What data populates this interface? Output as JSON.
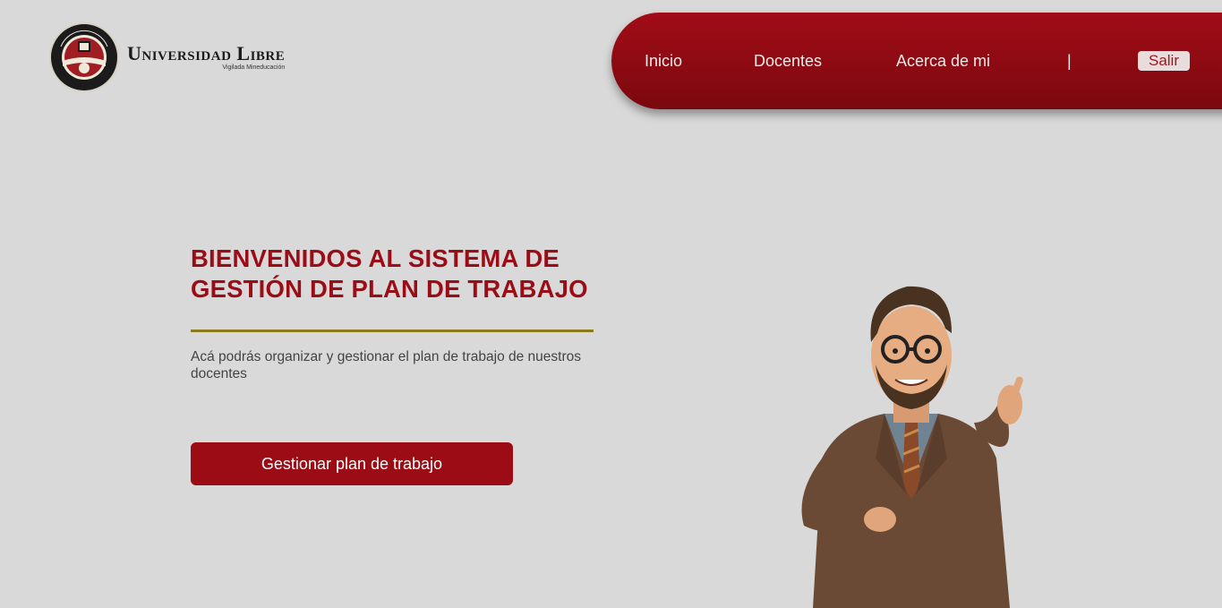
{
  "brand": {
    "name": "Universidad Libre",
    "tagline": "Vigilada Mineducación",
    "seal_top": "UNIVERSIDAD LIBRE",
    "seal_bottom": "COLOMBIA",
    "seal_motto": [
      "SCIENTIA",
      "VERITAS",
      "FRATERNITAS"
    ]
  },
  "nav": {
    "items": [
      {
        "label": "Inicio"
      },
      {
        "label": "Docentes"
      },
      {
        "label": "Acerca de mi"
      }
    ],
    "separator": "|",
    "logout_label": "Salir"
  },
  "hero": {
    "title": "BIENVENIDOS AL SISTEMA DE GESTIÓN DE PLAN DE TRABAJO",
    "description": "Acá podrás organizar y gestionar el plan de trabajo de nuestros docentes",
    "cta_label": "Gestionar plan de trabajo"
  },
  "colors": {
    "background": "#d9d9d9",
    "primary": "#9b0d16",
    "accent_line": "#8c7a1e"
  }
}
